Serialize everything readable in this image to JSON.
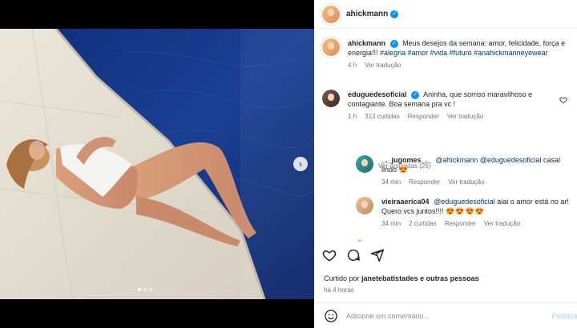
{
  "post": {
    "author": "ahickmann",
    "caption": "Meus desejos da semana: amor, felicidade, força e energia!!!",
    "hashtags": "#alegria #amor #vida #futuro #anahickmanneyewear",
    "time": "4 h",
    "translate": "Ver tradução"
  },
  "comments": [
    {
      "user": "eduguedesoficial",
      "text": "Aninha, que sorriso maravilhoso e contagiante. Boa semana pra vc !",
      "time": "1 h",
      "likes": "313 curtidas",
      "reply": "Responder",
      "translate": "Ver tradução",
      "view_replies": "Ver respostas (26)"
    }
  ],
  "replies": [
    {
      "user": "_._jugomes_._",
      "mention1": "@ahickmann",
      "mention2": "@eduguedesoficial",
      "text": "casal lindo",
      "emoji": "😍",
      "time": "34 min",
      "reply": "Responder",
      "translate": "Ver tradução"
    },
    {
      "user": "vieiraaerica04",
      "mention": "@eduguedesoficial",
      "text": "aiai o amor está no ar! Quero vcs juntos!!!!",
      "emoji": "😍😍😍😍",
      "time": "34 min",
      "likes": "2 curtidas",
      "reply": "Responder",
      "translate": "Ver tradução"
    }
  ],
  "footer": {
    "liked_prefix": "Curtido por",
    "liked_user": "janetebatistades",
    "liked_suffix": "e outras pessoas",
    "time": "há 4 horas",
    "comment_placeholder": "Adicione um comentário...",
    "post_label": "Publicar"
  },
  "carousel": {
    "slides": 3,
    "current": 1
  },
  "colors": {
    "link": "#00376b",
    "verified": "#0095f6",
    "heart": "#ed4956",
    "muted": "#737373"
  }
}
